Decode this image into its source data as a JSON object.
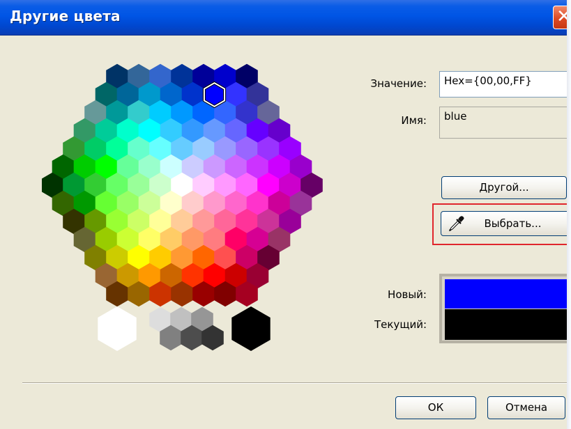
{
  "window": {
    "title": "Другие цвета"
  },
  "value_label": "Значение:",
  "value_text": "Hex={00,00,FF}",
  "name_label": "Имя:",
  "name_text": "blue",
  "other_button": "Другой...",
  "pick_button": "Выбрать...",
  "new_label": "Новый:",
  "current_label": "Текущий:",
  "ok_button": "ОК",
  "cancel_button": "Отмена",
  "colors": {
    "new": "#0000ff",
    "current": "#000000",
    "highlight": "#e0262c",
    "titlebar": "#0055e5"
  },
  "palette_rows": [
    [
      "#003366",
      "#336699",
      "#3366cc",
      "#003399",
      "#000099",
      "#0000cc",
      "#000066"
    ],
    [
      "#006666",
      "#006699",
      "#0099cc",
      "#0066cc",
      "#0033cc",
      "#0000ff",
      "#3333ff",
      "#333399"
    ],
    [
      "#669999",
      "#009999",
      "#33cccc",
      "#00ccff",
      "#0099ff",
      "#0066ff",
      "#3366ff",
      "#3333cc",
      "#666699"
    ],
    [
      "#339966",
      "#00cc99",
      "#00ffcc",
      "#00ffff",
      "#33ccff",
      "#3399ff",
      "#6699ff",
      "#6666ff",
      "#6600ff",
      "#6600cc"
    ],
    [
      "#339933",
      "#00cc66",
      "#00ff99",
      "#66ffcc",
      "#66ffff",
      "#66ccff",
      "#99ccff",
      "#9999ff",
      "#9966ff",
      "#9933ff",
      "#9900ff"
    ],
    [
      "#006600",
      "#00cc00",
      "#00ff00",
      "#66ff99",
      "#99ffcc",
      "#ccffff",
      "#ccccff",
      "#cc99ff",
      "#cc66ff",
      "#cc33ff",
      "#cc00ff",
      "#9900cc"
    ],
    [
      "#003300",
      "#009933",
      "#33cc33",
      "#66ff66",
      "#99ff99",
      "#ccffcc",
      "#ffffff",
      "#ffccff",
      "#ff99ff",
      "#ff66ff",
      "#ff00ff",
      "#cc00cc",
      "#660066"
    ],
    [
      "#336600",
      "#009900",
      "#66ff33",
      "#99ff66",
      "#ccff99",
      "#ffffcc",
      "#ffcccc",
      "#ff99cc",
      "#ff66cc",
      "#ff33cc",
      "#cc0099",
      "#993399"
    ],
    [
      "#333300",
      "#669900",
      "#99ff33",
      "#ccff66",
      "#ffff99",
      "#ffcc99",
      "#ff9999",
      "#ff6699",
      "#ff3399",
      "#cc3399",
      "#990099"
    ],
    [
      "#666633",
      "#99cc00",
      "#ccff33",
      "#ffff66",
      "#ffcc66",
      "#ff9966",
      "#ff7c80",
      "#ff0066",
      "#d60093",
      "#993366"
    ],
    [
      "#808000",
      "#cccc00",
      "#ffff00",
      "#ffcc00",
      "#ff9933",
      "#ff6600",
      "#ff5050",
      "#cc0066",
      "#660033"
    ],
    [
      "#996633",
      "#cc9900",
      "#ff9900",
      "#cc6600",
      "#ff3300",
      "#ff0000",
      "#cc0000",
      "#990033"
    ],
    [
      "#663300",
      "#996600",
      "#cc3300",
      "#993300",
      "#990000",
      "#800000",
      "#a50021"
    ]
  ],
  "gray_swatches": [
    "#ffffff",
    "#dddddd",
    "#c0c0c0",
    "#969696",
    "#808080",
    "#4d4d4d",
    "#333333",
    "#000000"
  ]
}
